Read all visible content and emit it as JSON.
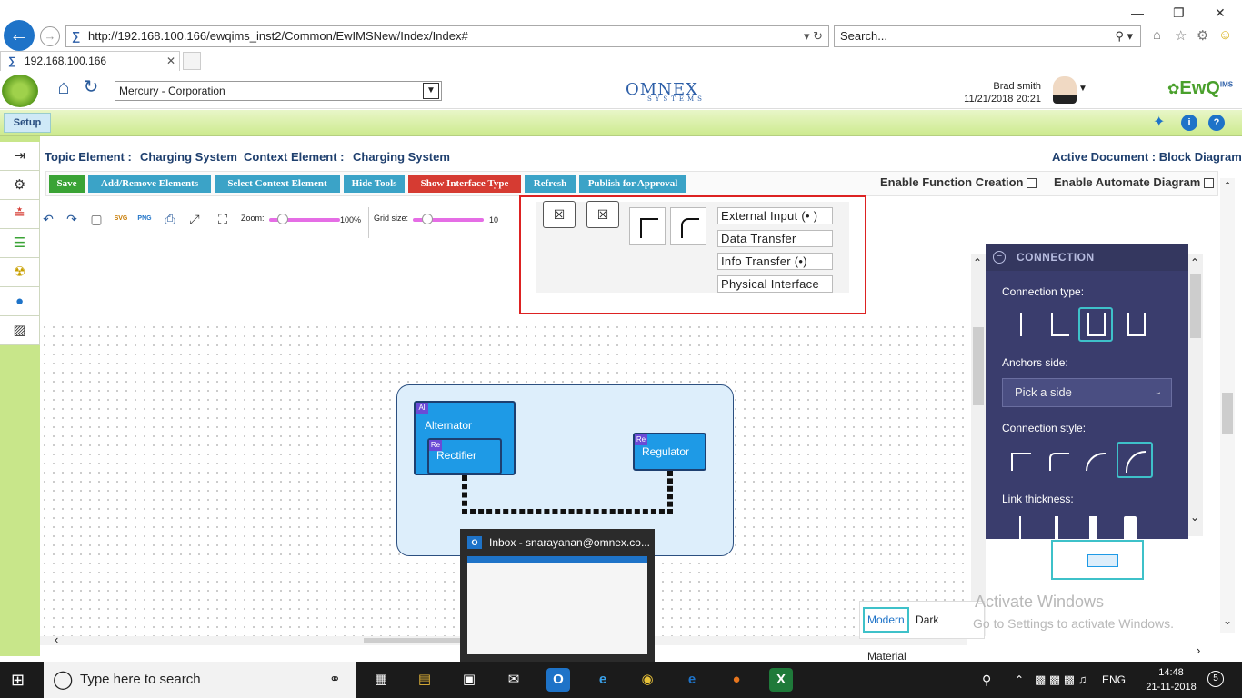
{
  "browser": {
    "url": "http://192.168.100.166/ewqims_inst2/Common/EwIMSNew/Index/Index#",
    "search_placeholder": "Search...",
    "tab_title": "192.168.100.166"
  },
  "header": {
    "org_select": "Mercury - Corporation",
    "brand": "OMNEX",
    "brand_sub": "SYSTEMS",
    "user_name": "Brad smith",
    "datetime": "11/21/2018 20:21",
    "product": "EwQ",
    "product_super": "IMS"
  },
  "setup_bar": {
    "setup_label": "Setup"
  },
  "topic": {
    "topic_label": "Topic Element :",
    "topic_value": "Charging System",
    "context_label": "Context Element :",
    "context_value": "Charging System",
    "active_doc": "Active Document : Block Diagram"
  },
  "toolbar": {
    "save": "Save",
    "add_remove": "Add/Remove Elements",
    "select_context": "Select Context Element",
    "hide_tools": "Hide Tools",
    "show_interface": "Show Interface Type",
    "refresh": "Refresh",
    "publish": "Publish for Approval",
    "enable_function": "Enable Function Creation",
    "enable_automate": "Enable Automate Diagram",
    "zoom_label": "Zoom:",
    "zoom_value": "100%",
    "grid_label": "Grid size:",
    "grid_value": "10",
    "svg": "SVG",
    "png": "PNG"
  },
  "interface_types": {
    "items": [
      "External Input (• )",
      "Data Transfer",
      "Info Transfer (•)",
      "Physical Interface"
    ]
  },
  "diagram": {
    "alternator": "Alternator",
    "alternator_tag": "Al",
    "rectifier": "Rectifier",
    "rectifier_tag": "Re",
    "regulator": "Regulator",
    "regulator_tag": "Re"
  },
  "connection_panel": {
    "title": "CONNECTION",
    "type_label": "Connection type:",
    "anchors_label": "Anchors side:",
    "anchors_value": "Pick a side",
    "style_label": "Connection style:",
    "thickness_label": "Link thickness:"
  },
  "themes": {
    "modern": "Modern",
    "dark": "Dark",
    "material": "Material"
  },
  "watermark": {
    "line1": "Activate Windows",
    "line2": "Go to Settings to activate Windows."
  },
  "preview": {
    "title": "Inbox - snarayanan@omnex.co..."
  },
  "taskbar": {
    "search_placeholder": "Type here to search",
    "lang": "ENG",
    "time": "14:48",
    "date": "21-11-2018",
    "notifications": "5"
  },
  "colors": {
    "save": "#3aa335",
    "blue_btn": "#3ba3c7",
    "red_btn": "#d63b32",
    "panel": "#3a3d6d",
    "accent": "#3ec1c9"
  }
}
